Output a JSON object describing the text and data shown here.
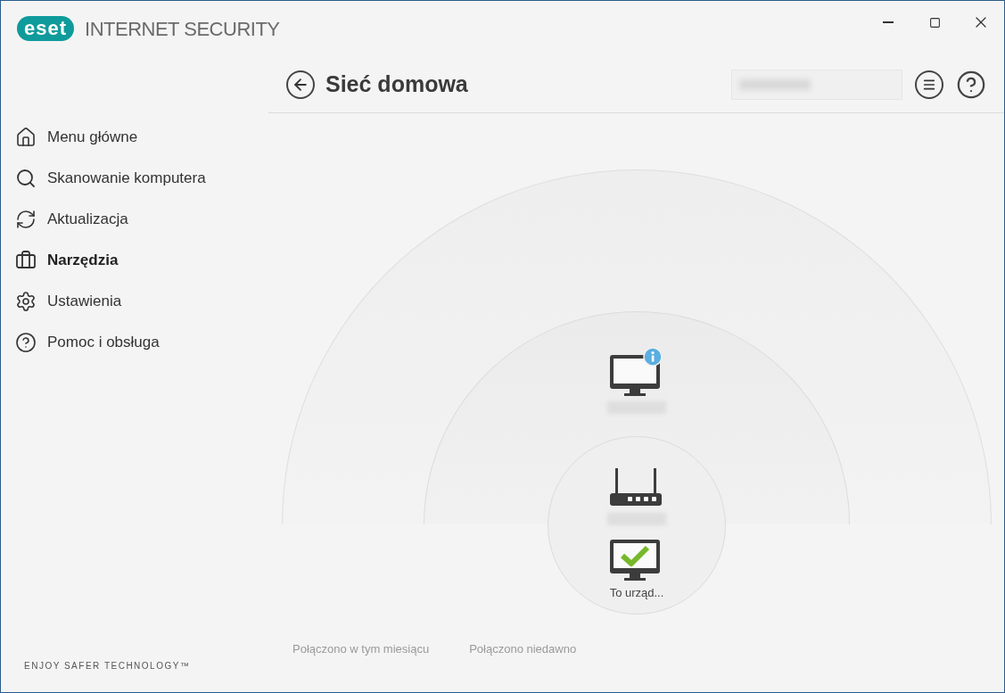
{
  "logo": {
    "mark": "eset",
    "product": "INTERNET SECURITY"
  },
  "page": {
    "title": "Sieć domowa"
  },
  "sidebar": {
    "items": [
      {
        "label": "Menu główne",
        "selected": false
      },
      {
        "label": "Skanowanie komputera",
        "selected": false
      },
      {
        "label": "Aktualizacja",
        "selected": false
      },
      {
        "label": "Narzędzia",
        "selected": true
      },
      {
        "label": "Ustawienia",
        "selected": false
      },
      {
        "label": "Pomoc i obsługa",
        "selected": false
      }
    ],
    "footer": "ENJOY SAFER TECHNOLOGY™"
  },
  "network": {
    "nodes": [
      {
        "kind": "computer-info"
      },
      {
        "kind": "router"
      },
      {
        "kind": "computer-ok",
        "label": "To urząd..."
      }
    ],
    "legend": [
      "Połączono w tym miesiącu",
      "Połączono niedawno"
    ]
  }
}
